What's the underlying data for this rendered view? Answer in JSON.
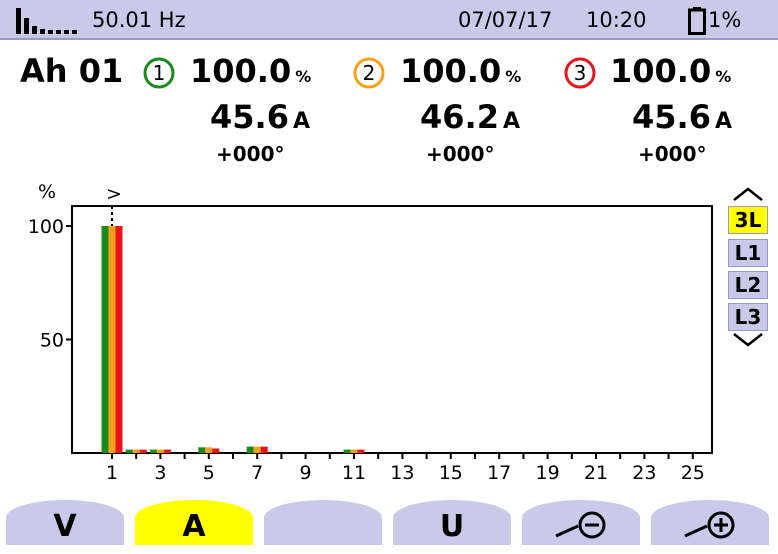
{
  "status": {
    "frequency": "50.01 Hz",
    "date": "07/07/17",
    "time": "10:20",
    "battery": "1%"
  },
  "header": {
    "mode": "Ah 01"
  },
  "phases": [
    {
      "num": "1",
      "percent": "100.0",
      "percent_unit": "%",
      "current": "45.6",
      "current_unit": "A",
      "angle": "+000°",
      "color": "#1a8a1a"
    },
    {
      "num": "2",
      "percent": "100.0",
      "percent_unit": "%",
      "current": "46.2",
      "current_unit": "A",
      "angle": "+000°",
      "color": "#f5a21a"
    },
    {
      "num": "3",
      "percent": "100.0",
      "percent_unit": "%",
      "current": "45.6",
      "current_unit": "A",
      "angle": "+000°",
      "color": "#e8141a"
    }
  ],
  "sidebar": {
    "items": [
      {
        "label": "3L",
        "active": true
      },
      {
        "label": "L1",
        "active": false
      },
      {
        "label": "L2",
        "active": false
      },
      {
        "label": "L3",
        "active": false
      }
    ]
  },
  "softkeys": [
    {
      "label": "V",
      "active": false,
      "icon": ""
    },
    {
      "label": "A",
      "active": true,
      "icon": ""
    },
    {
      "label": "",
      "active": false,
      "icon": ""
    },
    {
      "label": "U",
      "active": false,
      "icon": ""
    },
    {
      "label": "",
      "active": false,
      "icon": "zoom-out-icon"
    },
    {
      "label": "",
      "active": false,
      "icon": "zoom-in-icon"
    }
  ],
  "chart_data": {
    "type": "bar",
    "ylabel": "%",
    "ylim": [
      0,
      100
    ],
    "yticks": [
      50,
      100
    ],
    "cursor_marker": ">",
    "categories": [
      "1",
      "2",
      "3",
      "4",
      "5",
      "6",
      "7",
      "8",
      "9",
      "10",
      "11",
      "12",
      "13",
      "14",
      "15",
      "16",
      "17",
      "18",
      "19",
      "20",
      "21",
      "22",
      "23",
      "24",
      "25"
    ],
    "xtick_labels": [
      "1",
      "3",
      "5",
      "7",
      "9",
      "11",
      "13",
      "15",
      "17",
      "19",
      "21",
      "23",
      "25"
    ],
    "series": [
      {
        "color": "#1a8a1a",
        "values": [
          100,
          1.5,
          1.5,
          0,
          2.5,
          0,
          2.8,
          0,
          0,
          0,
          1.5,
          0,
          0,
          0,
          0,
          0,
          0,
          0,
          0,
          0,
          0,
          0,
          0,
          0,
          0
        ]
      },
      {
        "color": "#f5a21a",
        "values": [
          100,
          1.5,
          1.5,
          0,
          2.5,
          0,
          2.8,
          0,
          0,
          0,
          1.5,
          0,
          0,
          0,
          0,
          0,
          0,
          0,
          0,
          0,
          0,
          0,
          0,
          0,
          0
        ]
      },
      {
        "color": "#e8141a",
        "values": [
          100,
          1.5,
          1.5,
          0,
          2.0,
          0,
          2.8,
          0,
          0,
          0,
          1.5,
          0,
          0,
          0,
          0,
          0,
          0,
          0,
          0,
          0,
          0,
          0,
          0,
          0,
          0
        ]
      }
    ]
  }
}
